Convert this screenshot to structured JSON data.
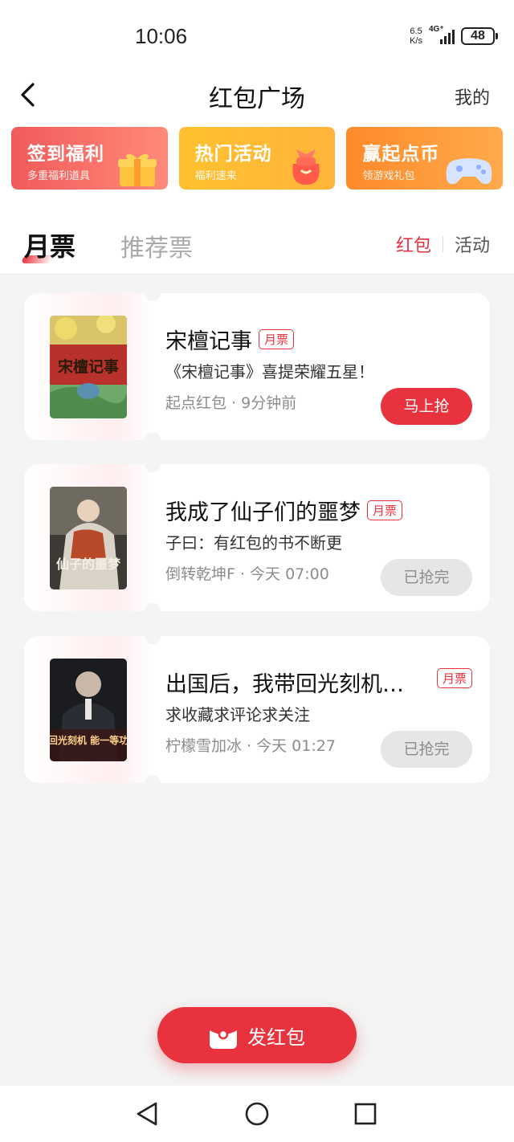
{
  "status_bar": {
    "time": "10:06",
    "net_speed_top": "6.5",
    "net_speed_bottom": "K/s",
    "network": "4G⁺",
    "battery": "48"
  },
  "header": {
    "title": "红包广场",
    "mine": "我的",
    "back_icon": "chevron-left-icon"
  },
  "promos": [
    {
      "title": "签到福利",
      "subtitle": "多重福利道具",
      "icon": "gift-icon",
      "color": "#f25a5a"
    },
    {
      "title": "热门活动",
      "subtitle": "福利速来",
      "icon": "lucky-bag-icon",
      "color": "#ffc12f"
    },
    {
      "title": "赢起点币",
      "subtitle": "领游戏礼包",
      "icon": "gamepad-icon",
      "color": "#ff8a2a"
    }
  ],
  "tabs": {
    "monthly": "月票",
    "recommend": "推荐票",
    "red_packet": "红包",
    "activity": "活动"
  },
  "list": [
    {
      "title": "宋檀记事",
      "tag": "月票",
      "desc": "《宋檀记事》喜提荣耀五星！",
      "meta": "起点红包 · 9分钟前",
      "button": "马上抢",
      "button_state": "active",
      "cover_text": "宋檀记事"
    },
    {
      "title": "我成了仙子们的噩梦",
      "tag": "月票",
      "desc": "子曰：有红包的书不断更",
      "meta": "倒转乾坤F · 今天 07:00",
      "button": "已抢完",
      "button_state": "done",
      "cover_text": "仙子的噩梦"
    },
    {
      "title": "出国后，我带回光刻机…",
      "tag": "月票",
      "desc": "求收藏求评论求关注",
      "meta": "柠檬雪加冰 · 今天 01:27",
      "button": "已抢完",
      "button_state": "done",
      "cover_text": "带回光刻机 能一等功吗"
    }
  ],
  "send_button": {
    "label": "发红包",
    "icon": "red-packet-icon"
  },
  "nav": {
    "back": "triangle-back-icon",
    "home": "circle-home-icon",
    "recents": "square-recents-icon"
  },
  "colors": {
    "accent": "#e8333f",
    "muted": "#8c8c8c"
  }
}
